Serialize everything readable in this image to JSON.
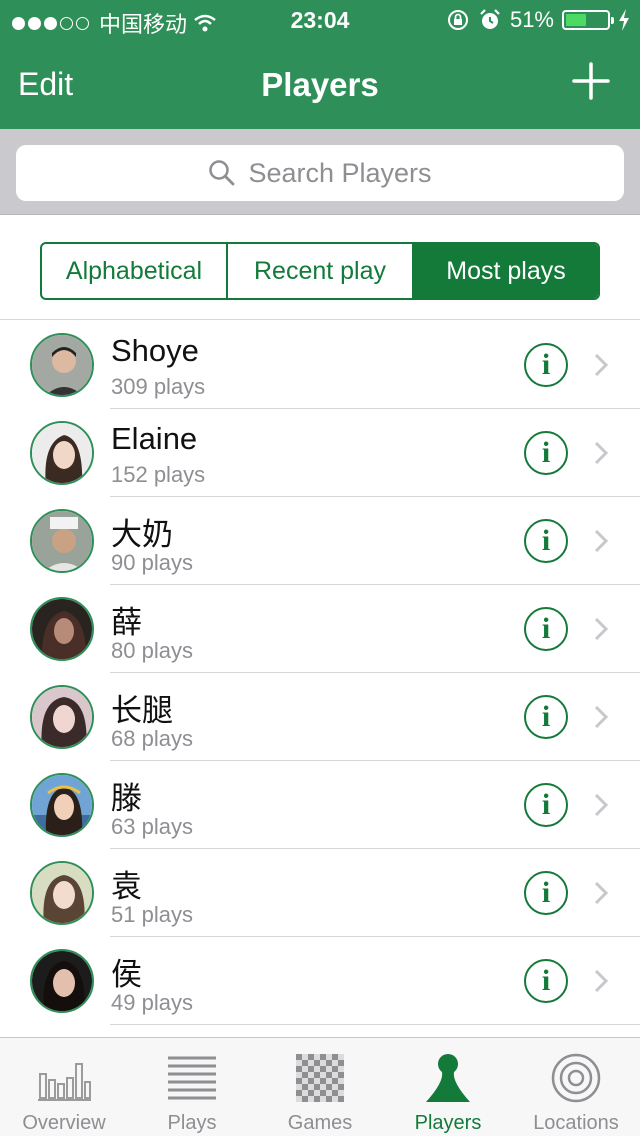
{
  "status_bar": {
    "carrier": "中国移动",
    "time": "23:04",
    "battery": "51%",
    "battery_level": 0.51
  },
  "nav": {
    "edit_label": "Edit",
    "title": "Players"
  },
  "search": {
    "placeholder": "Search Players"
  },
  "segments": [
    {
      "label": "Alphabetical",
      "selected": false
    },
    {
      "label": "Recent play",
      "selected": false
    },
    {
      "label": "Most plays",
      "selected": true
    }
  ],
  "players": [
    {
      "name": "Shoye",
      "plays": "309 plays"
    },
    {
      "name": "Elaine",
      "plays": "152 plays"
    },
    {
      "name": "大奶",
      "plays": "90 plays"
    },
    {
      "name": "薛",
      "plays": "80 plays"
    },
    {
      "name": "长腿",
      "plays": "68 plays"
    },
    {
      "name": "滕",
      "plays": "63 plays"
    },
    {
      "name": "袁",
      "plays": "51 plays"
    },
    {
      "name": "侯",
      "plays": "49 plays"
    }
  ],
  "tabs": [
    {
      "label": "Overview",
      "icon": "bar-chart-icon",
      "active": false
    },
    {
      "label": "Plays",
      "icon": "list-lines-icon",
      "active": false
    },
    {
      "label": "Games",
      "icon": "checkerboard-icon",
      "active": false
    },
    {
      "label": "Players",
      "icon": "pawn-icon",
      "active": true
    },
    {
      "label": "Locations",
      "icon": "target-icon",
      "active": false
    }
  ],
  "colors": {
    "brand_green": "#2e9058",
    "accent_green": "#137a3a",
    "battery_green": "#4cd964"
  }
}
